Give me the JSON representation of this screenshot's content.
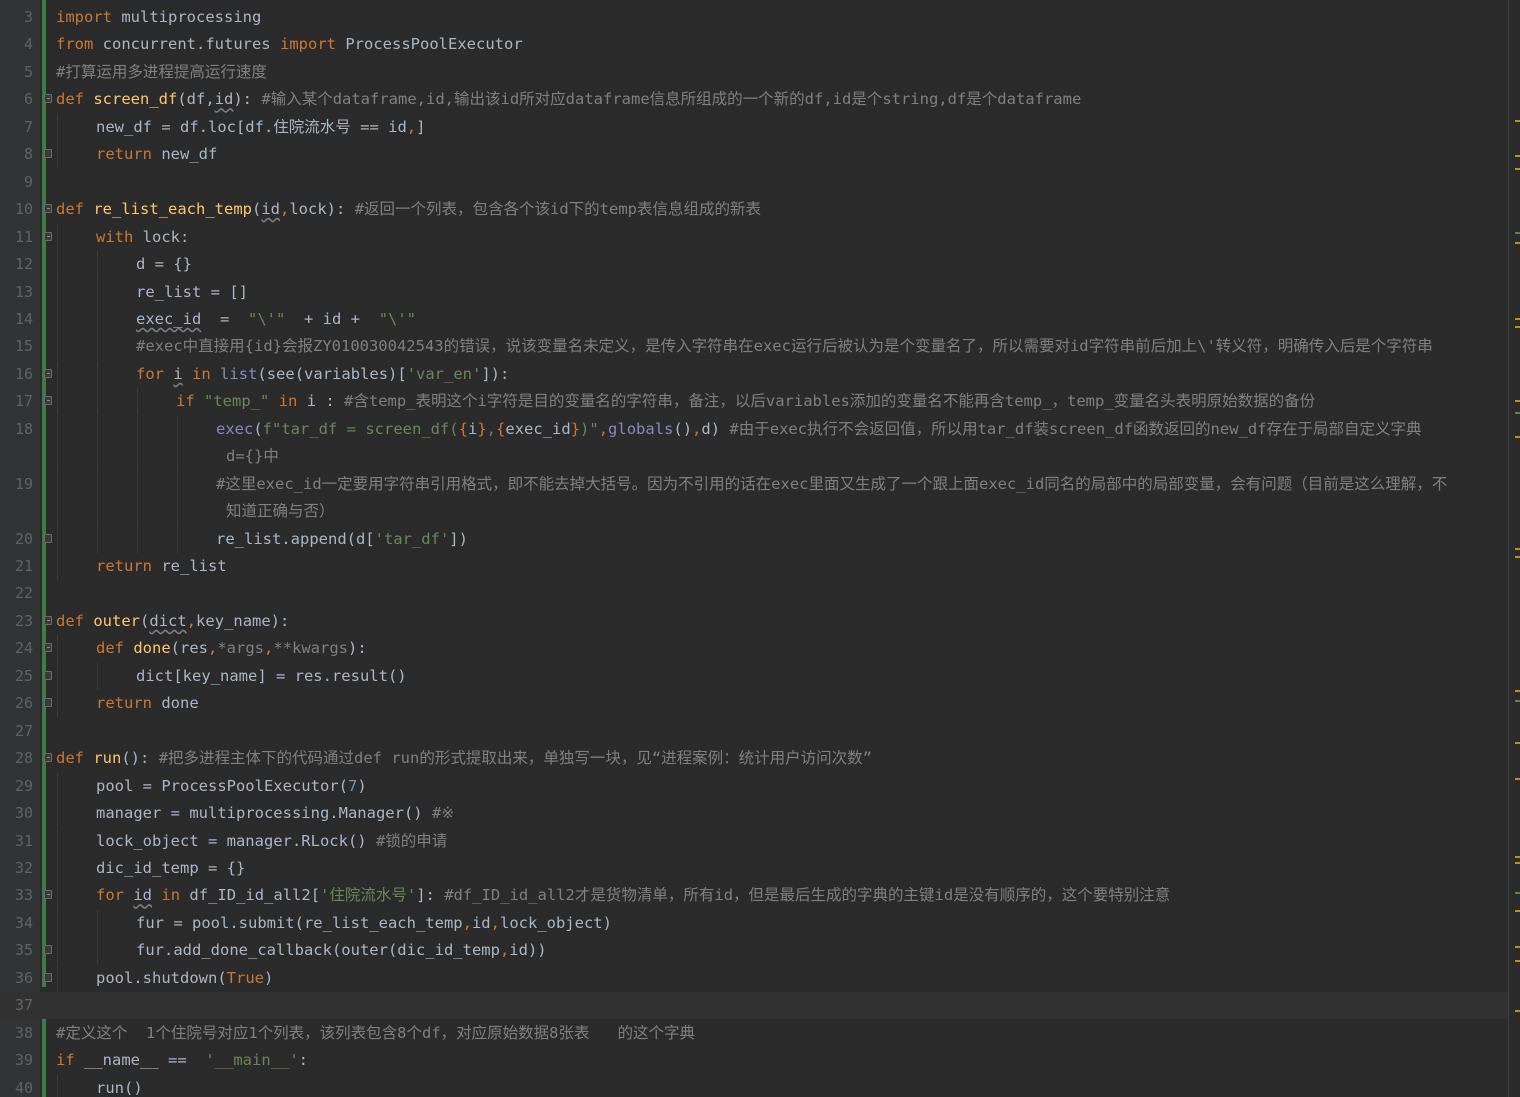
{
  "editor": {
    "language": "python",
    "current_line": 37,
    "colors": {
      "keyword": "#cc7832",
      "function": "#ffc66d",
      "string": "#6a8759",
      "comment": "#808080",
      "number": "#6897bb",
      "builtin": "#8888c6",
      "param": "#94558d",
      "text": "#a9b7c6",
      "background": "#2b2b2b",
      "vcs_added": "#3f7b45"
    },
    "lines": [
      {
        "n": "3",
        "indent": 0,
        "segs": [
          [
            "k",
            "import"
          ],
          [
            "",
            "multiprocessing"
          ]
        ]
      },
      {
        "n": "4",
        "indent": 0,
        "segs": [
          [
            "k",
            "from"
          ],
          [
            "",
            "concurrent.futures"
          ],
          [
            "k",
            "import"
          ],
          [
            "",
            "ProcessPoolExecutor"
          ]
        ]
      },
      {
        "n": "5",
        "indent": 0,
        "segs": [
          [
            "c",
            "#打算运用多进程提高运行速度"
          ]
        ]
      },
      {
        "n": "6",
        "indent": 0,
        "fold": "open",
        "segs": [
          [
            "k",
            "def"
          ],
          [
            "f",
            "screen_df"
          ],
          [
            "",
            "(df,"
          ],
          [
            "u",
            "id"
          ],
          [
            "",
            "):"
          ],
          [
            "c",
            "#输入某个dataframe,id,输出该id所对应dataframe信息所组成的一个新的df,id是个string,df是个dataframe"
          ]
        ]
      },
      {
        "n": "7",
        "indent": 1,
        "segs": [
          [
            "",
            "new_df = df.loc[df.住院流水号 == id"
          ],
          [
            "k",
            ","
          ],
          [
            "",
            "]"
          ]
        ]
      },
      {
        "n": "8",
        "indent": 1,
        "fold": "close",
        "segs": [
          [
            "k",
            "return"
          ],
          [
            "",
            "new_df"
          ]
        ]
      },
      {
        "n": "9",
        "indent": 0,
        "segs": []
      },
      {
        "n": "10",
        "indent": 0,
        "fold": "open",
        "segs": [
          [
            "k",
            "def"
          ],
          [
            "f",
            "re_list_each_temp"
          ],
          [
            "",
            "("
          ],
          [
            "u",
            "id"
          ],
          [
            "k",
            ","
          ],
          [
            "",
            "lock):"
          ],
          [
            "c",
            "#返回一个列表，包含各个该id下的temp表信息组成的新表"
          ]
        ]
      },
      {
        "n": "11",
        "indent": 1,
        "fold": "open",
        "segs": [
          [
            "k",
            "with"
          ],
          [
            "",
            "lock:"
          ]
        ]
      },
      {
        "n": "12",
        "indent": 2,
        "segs": [
          [
            "",
            "d = {}"
          ]
        ]
      },
      {
        "n": "13",
        "indent": 2,
        "segs": [
          [
            "",
            "re_list = []"
          ]
        ]
      },
      {
        "n": "14",
        "indent": 2,
        "segs": [
          [
            "u",
            "exec_id"
          ],
          [
            "",
            " = "
          ],
          [
            "s",
            "\"\\'\""
          ],
          [
            "",
            " + id + "
          ],
          [
            "s",
            "\"\\'\""
          ]
        ]
      },
      {
        "n": "15",
        "indent": 2,
        "segs": [
          [
            "c",
            "#exec中直接用{id}会报ZY010030042543的错误，说该变量名未定义，是传入字符串在exec运行后被认为是个变量名了，所以需要对id字符串前后加上\\'转义符，明确传入后是个字符串"
          ]
        ]
      },
      {
        "n": "16",
        "indent": 2,
        "fold": "open",
        "segs": [
          [
            "k",
            "for"
          ],
          [
            "u",
            "i"
          ],
          [
            "k",
            "in"
          ],
          [
            "b",
            "list"
          ],
          [
            "",
            "(see(variables)["
          ],
          [
            "s",
            "'var_en'"
          ],
          [
            "",
            "]):"
          ]
        ]
      },
      {
        "n": "17",
        "indent": 3,
        "fold": "open",
        "segs": [
          [
            "k",
            "if"
          ],
          [
            "s",
            "\"temp_\""
          ],
          [
            "k",
            "in"
          ],
          [
            "",
            "i :"
          ],
          [
            "c",
            "#含temp_表明这个i字符是目的变量名的字符串，备注，以后variables添加的变量名不能再含temp_，temp_变量名头表明原始数据的备份"
          ]
        ]
      },
      {
        "n": "18",
        "indent": 4,
        "segs": [
          [
            "b",
            "exec"
          ],
          [
            "",
            "("
          ],
          [
            "s",
            "f\"tar_df = screen_df("
          ],
          [
            "k",
            "{"
          ],
          [
            "",
            "i"
          ],
          [
            "k",
            "}"
          ],
          [
            "s",
            ","
          ],
          [
            "k",
            "{"
          ],
          [
            "",
            "exec_id"
          ],
          [
            "k",
            "}"
          ],
          [
            "s",
            ")\""
          ],
          [
            "k",
            ","
          ],
          [
            "b",
            "globals"
          ],
          [
            "",
            "()"
          ],
          [
            "k",
            ","
          ],
          [
            "",
            "d)"
          ],
          [
            "c",
            "#由于exec执行不会返回值，所以用tar_df装screen_df函数返回的new_df存在于局部自定义字典"
          ]
        ]
      },
      {
        "n": "",
        "indent": 4,
        "cont": true,
        "segs": [
          [
            "c",
            "d={}中"
          ]
        ]
      },
      {
        "n": "19",
        "indent": 4,
        "segs": [
          [
            "c",
            "#这里exec_id一定要用字符串引用格式，即不能去掉大括号。因为不引用的话在exec里面又生成了一个跟上面exec_id同名的局部中的局部变量，会有问题（目前是这么理解，不"
          ]
        ]
      },
      {
        "n": "",
        "indent": 4,
        "cont": true,
        "segs": [
          [
            "c",
            "知道正确与否）"
          ]
        ]
      },
      {
        "n": "20",
        "indent": 4,
        "fold": "close",
        "segs": [
          [
            "",
            "re_list.append(d["
          ],
          [
            "s",
            "'tar_df'"
          ],
          [
            "",
            "])"
          ]
        ]
      },
      {
        "n": "21",
        "indent": 1,
        "segs": [
          [
            "k",
            "return"
          ],
          [
            "",
            "re_list"
          ]
        ]
      },
      {
        "n": "22",
        "indent": 0,
        "segs": []
      },
      {
        "n": "23",
        "indent": 0,
        "fold": "open",
        "segs": [
          [
            "k",
            "def"
          ],
          [
            "f",
            "outer"
          ],
          [
            "",
            "("
          ],
          [
            "u",
            "dict"
          ],
          [
            "k",
            ","
          ],
          [
            "",
            "key_name):"
          ]
        ]
      },
      {
        "n": "24",
        "indent": 1,
        "fold": "open",
        "segs": [
          [
            "k",
            "def"
          ],
          [
            "f",
            "done"
          ],
          [
            "",
            "(res"
          ],
          [
            "k",
            ","
          ],
          [
            "c",
            "*args"
          ],
          [
            "k",
            ","
          ],
          [
            "c",
            "**kwargs"
          ],
          [
            "",
            "):"
          ]
        ]
      },
      {
        "n": "25",
        "indent": 2,
        "fold": "close",
        "segs": [
          [
            "",
            "dict[key_name] = res.result()"
          ]
        ]
      },
      {
        "n": "26",
        "indent": 1,
        "fold": "close",
        "segs": [
          [
            "k",
            "return"
          ],
          [
            "",
            "done"
          ]
        ]
      },
      {
        "n": "27",
        "indent": 0,
        "segs": []
      },
      {
        "n": "28",
        "indent": 0,
        "fold": "open",
        "segs": [
          [
            "k",
            "def"
          ],
          [
            "f",
            "run"
          ],
          [
            "",
            "():"
          ],
          [
            "c",
            "#把多进程主体下的代码通过def run的形式提取出来，单独写一块，见“进程案例：统计用户访问次数”"
          ]
        ]
      },
      {
        "n": "29",
        "indent": 1,
        "segs": [
          [
            "",
            "pool = ProcessPoolExecutor("
          ],
          [
            "n",
            "7"
          ],
          [
            "",
            ")"
          ]
        ]
      },
      {
        "n": "30",
        "indent": 1,
        "segs": [
          [
            "",
            "manager = multiprocessing.Manager()"
          ],
          [
            "c",
            "#※"
          ]
        ]
      },
      {
        "n": "31",
        "indent": 1,
        "segs": [
          [
            "",
            "lock_object = manager.RLock()"
          ],
          [
            "c",
            "#锁的申请"
          ]
        ]
      },
      {
        "n": "32",
        "indent": 1,
        "segs": [
          [
            "",
            "dic_id_temp = {}"
          ]
        ]
      },
      {
        "n": "33",
        "indent": 1,
        "fold": "open",
        "segs": [
          [
            "k",
            "for"
          ],
          [
            "u",
            "id"
          ],
          [
            "k",
            "in"
          ],
          [
            "",
            "df_ID_id_all2["
          ],
          [
            "s",
            "'住院流水号'"
          ],
          [
            "",
            "]:"
          ],
          [
            "c",
            "#df_ID_id_all2才是货物清单，所有id，但是最后生成的字典的主键id是没有顺序的，这个要特别注意"
          ]
        ]
      },
      {
        "n": "34",
        "indent": 2,
        "segs": [
          [
            "",
            "fur = pool.submit(re_list_each_temp"
          ],
          [
            "k",
            ","
          ],
          [
            "",
            "id"
          ],
          [
            "k",
            ","
          ],
          [
            "",
            "lock_object)"
          ]
        ]
      },
      {
        "n": "35",
        "indent": 2,
        "fold": "close",
        "segs": [
          [
            "",
            "fur.add_done_callback(outer(dic_id_temp"
          ],
          [
            "k",
            ","
          ],
          [
            "",
            "id))"
          ]
        ]
      },
      {
        "n": "36",
        "indent": 1,
        "fold": "close",
        "segs": [
          [
            "",
            "pool.shutdown("
          ],
          [
            "k",
            "True"
          ],
          [
            "",
            ")"
          ]
        ]
      },
      {
        "n": "37",
        "indent": 0,
        "segs": []
      },
      {
        "n": "38",
        "indent": 0,
        "segs": [
          [
            "c",
            "#定义这个  1个住院号对应1个列表，该列表包含8个df，对应原始数据8张表   的这个字典"
          ]
        ]
      },
      {
        "n": "39",
        "indent": 0,
        "segs": [
          [
            "k",
            "if"
          ],
          [
            "",
            "__name__ == "
          ],
          [
            "s",
            "'__main__'"
          ],
          [
            "",
            ":"
          ]
        ]
      },
      {
        "n": "40",
        "indent": 1,
        "segs": [
          [
            "",
            "run()"
          ]
        ]
      }
    ]
  }
}
